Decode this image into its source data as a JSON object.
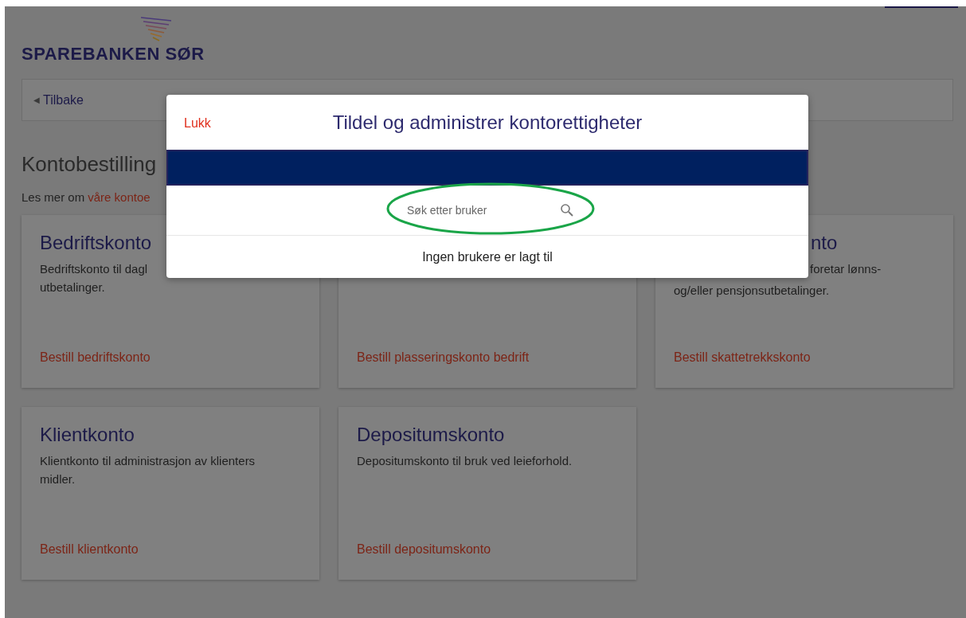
{
  "logo": {
    "text": "SPAREBANKEN SØR"
  },
  "back_link": {
    "icon": "◀",
    "label": "Tilbake"
  },
  "heading": "Kontobestilling",
  "intro": {
    "text": "Les mer om",
    "link": "våre kontoe"
  },
  "cards": [
    {
      "title": "Bedriftskonto",
      "description": [
        "Bedriftskonto til dagl",
        "utbetalinger."
      ],
      "link": "Bestill bedriftskonto"
    },
    {
      "link": "Bestill plasseringskonto bedrift"
    },
    {
      "title": "nto",
      "description": [
        "foretar lønns-",
        "og/eller pensjonsutbetalinger."
      ],
      "link": "Bestill skattetrekkskonto"
    },
    {
      "title": "Klientkonto",
      "description": [
        "Klientkonto til administrasjon av klienters",
        "midler."
      ],
      "link": "Bestill klientkonto"
    },
    {
      "title": "Depositumskonto",
      "description": [
        "Depositumskonto til bruk ved leieforhold."
      ],
      "link": "Bestill depositumskonto"
    }
  ],
  "modal": {
    "close": "Lukk",
    "title": "Tildel og administrer kontorettigheter",
    "search": {
      "placeholder": "Søk etter bruker"
    },
    "empty_message": "Ingen brukere er lagt til"
  }
}
